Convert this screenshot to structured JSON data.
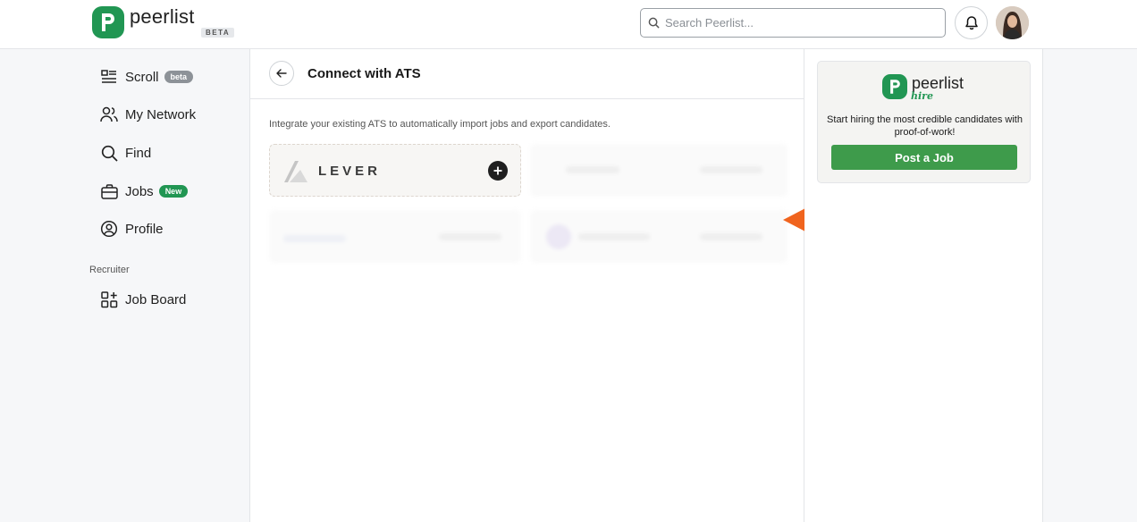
{
  "brand": {
    "name": "peerlist",
    "badge": "BETA"
  },
  "search": {
    "placeholder": "Search Peerlist..."
  },
  "sidebar": {
    "items": [
      {
        "label": "Scroll",
        "badge": "beta"
      },
      {
        "label": "My Network"
      },
      {
        "label": "Find"
      },
      {
        "label": "Jobs",
        "badge": "New"
      },
      {
        "label": "Profile"
      }
    ],
    "section_label": "Recruiter",
    "recruiter_items": [
      {
        "label": "Job Board"
      }
    ]
  },
  "main": {
    "title": "Connect with ATS",
    "description": "Integrate your existing ATS to automatically import jobs and export candidates.",
    "integrations": [
      {
        "name": "LEVER"
      }
    ]
  },
  "promo": {
    "brand": "peerlist",
    "sub": "hire",
    "text": "Start hiring the most credible candidates with proof-of-work!",
    "button_label": "Post a Job"
  },
  "colors": {
    "brand_green": "#219653",
    "arrow": "#f0641e",
    "button_green": "#3e9b4b"
  }
}
